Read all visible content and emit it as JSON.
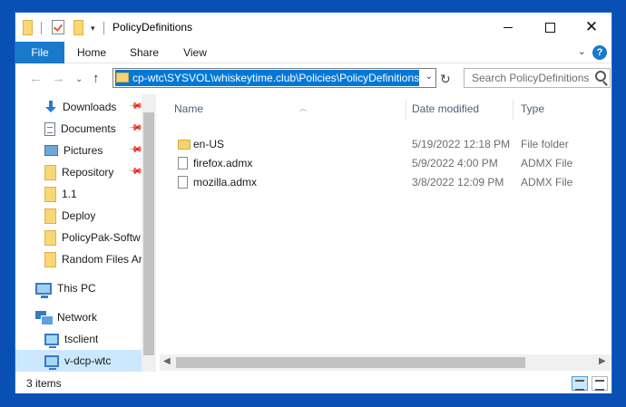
{
  "window": {
    "title": "PolicyDefinitions"
  },
  "ribbon": {
    "tabs": [
      "File",
      "Home",
      "Share",
      "View"
    ],
    "help": "?"
  },
  "address": {
    "path": "cp-wtc\\SYSVOL\\whiskeytime.club\\Policies\\PolicyDefinitions",
    "search_placeholder": "Search PolicyDefinitions"
  },
  "nav": {
    "items": [
      {
        "label": "Downloads",
        "icon": "download-icon",
        "pinned": true
      },
      {
        "label": "Documents",
        "icon": "document-icon",
        "pinned": true
      },
      {
        "label": "Pictures",
        "icon": "picture-icon",
        "pinned": true
      },
      {
        "label": "Repository",
        "icon": "folder-icon",
        "pinned": true
      },
      {
        "label": "1.1",
        "icon": "folder-icon",
        "pinned": false
      },
      {
        "label": "Deploy",
        "icon": "folder-icon",
        "pinned": false
      },
      {
        "label": "PolicyPak-Softw",
        "icon": "folder-icon",
        "pinned": false
      },
      {
        "label": "Random Files Ar",
        "icon": "folder-icon",
        "pinned": false
      },
      {
        "label": "This PC",
        "icon": "computer-icon",
        "pinned": false
      },
      {
        "label": "Network",
        "icon": "network-icon",
        "pinned": false
      },
      {
        "label": "tsclient",
        "icon": "monitor-icon",
        "pinned": false
      },
      {
        "label": "v-dcp-wtc",
        "icon": "monitor-icon",
        "pinned": false,
        "selected": true
      }
    ]
  },
  "columns": {
    "name": "Name",
    "date": "Date modified",
    "type": "Type"
  },
  "files": [
    {
      "name": "en-US",
      "date": "5/19/2022 12:18 PM",
      "type": "File folder",
      "icon": "folder-icon"
    },
    {
      "name": "firefox.admx",
      "date": "5/9/2022 4:00 PM",
      "type": "ADMX File",
      "icon": "file-icon"
    },
    {
      "name": "mozilla.admx",
      "date": "3/8/2022 12:09 PM",
      "type": "ADMX File",
      "icon": "file-icon"
    }
  ],
  "status": {
    "count": "3 items"
  },
  "colors": {
    "desktop": "#0a4fb4",
    "accent": "#1979ca",
    "selection": "#0078d7",
    "nav_selected": "#cce8ff"
  }
}
